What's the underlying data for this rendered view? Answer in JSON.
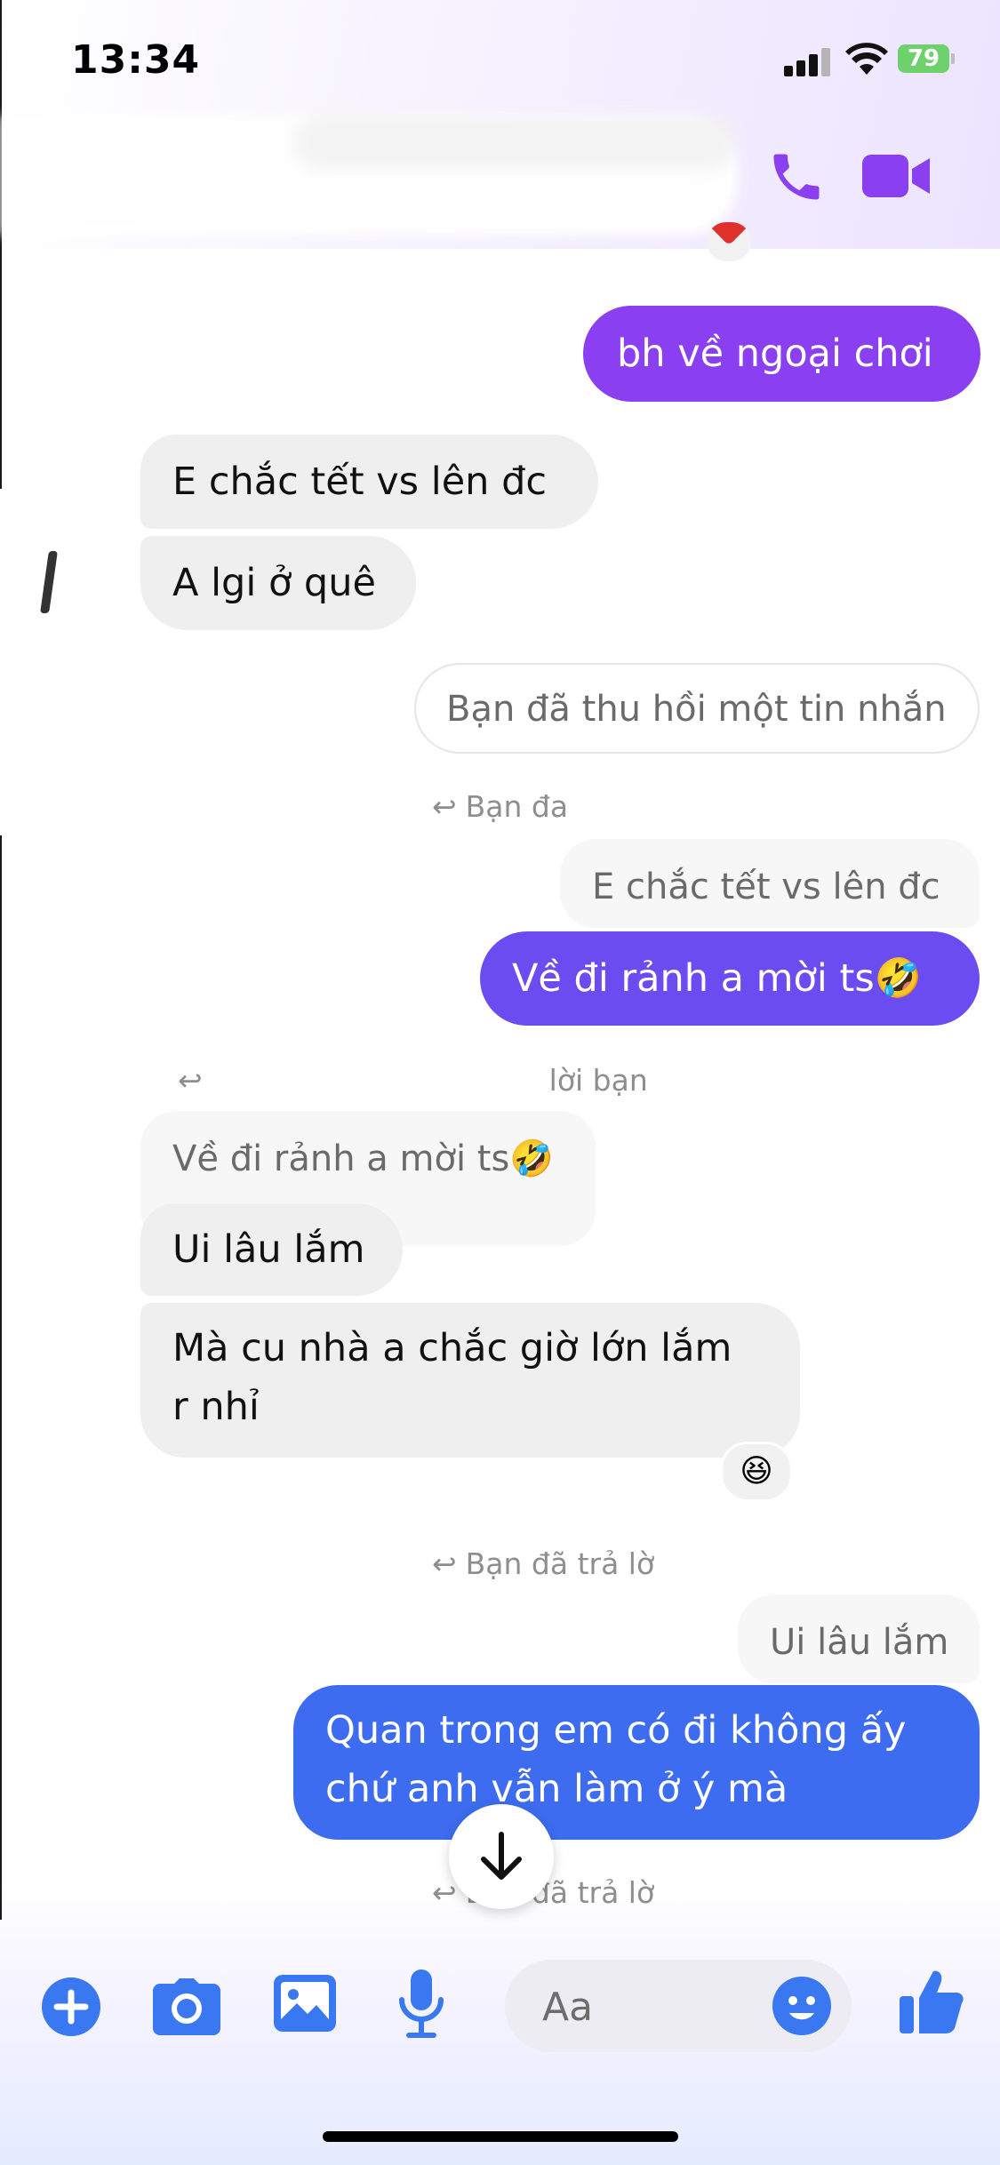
{
  "status_bar": {
    "time": "13:34",
    "battery": "79"
  },
  "header": {
    "call_icon": "phone-icon",
    "video_icon": "video-camera-icon"
  },
  "colors": {
    "accent_purple": "#8a3ff0",
    "accent_blue": "#3d6cf0",
    "accent_violet": "#6a4cf0",
    "incoming_bubble": "#efefef",
    "toolbar_blue": "#3a78f2"
  },
  "messages": {
    "m1": "bh về ngoại chơi",
    "m2": "E chắc tết vs lên đc",
    "m3": "A lgi ở quê",
    "m4": "Bạn đã thu hồi một tin nhắn",
    "m5_reply": "Bạn đa",
    "m5_quote": "E chắc tết vs lên đc",
    "m5": "Về đi rảnh a mời ts🤣",
    "m6_reply": "lời bạn",
    "m6_quote": "Về đi rảnh a mời ts🤣",
    "m6": "Ui lâu lắm",
    "m7_line1": "Mà cu nhà a chắc giờ lớn lắm",
    "m7_line2": "r nhỉ",
    "m7_reaction": "😆",
    "m8_reply": "Bạn đã trả lờ",
    "m8_quote": "Ui lâu lắm",
    "m8_line1": "Quan trong em có đi không ấy",
    "m8_line2": "chứ anh vẫn làm ở ý mà",
    "m9_reply": "Bạn đã trả lờ"
  },
  "composer": {
    "placeholder": "Aa"
  },
  "toolbar": {
    "icons": [
      "plus-icon",
      "camera-icon",
      "gallery-icon",
      "microphone-icon",
      "emoji-icon",
      "thumbs-up-icon"
    ]
  }
}
